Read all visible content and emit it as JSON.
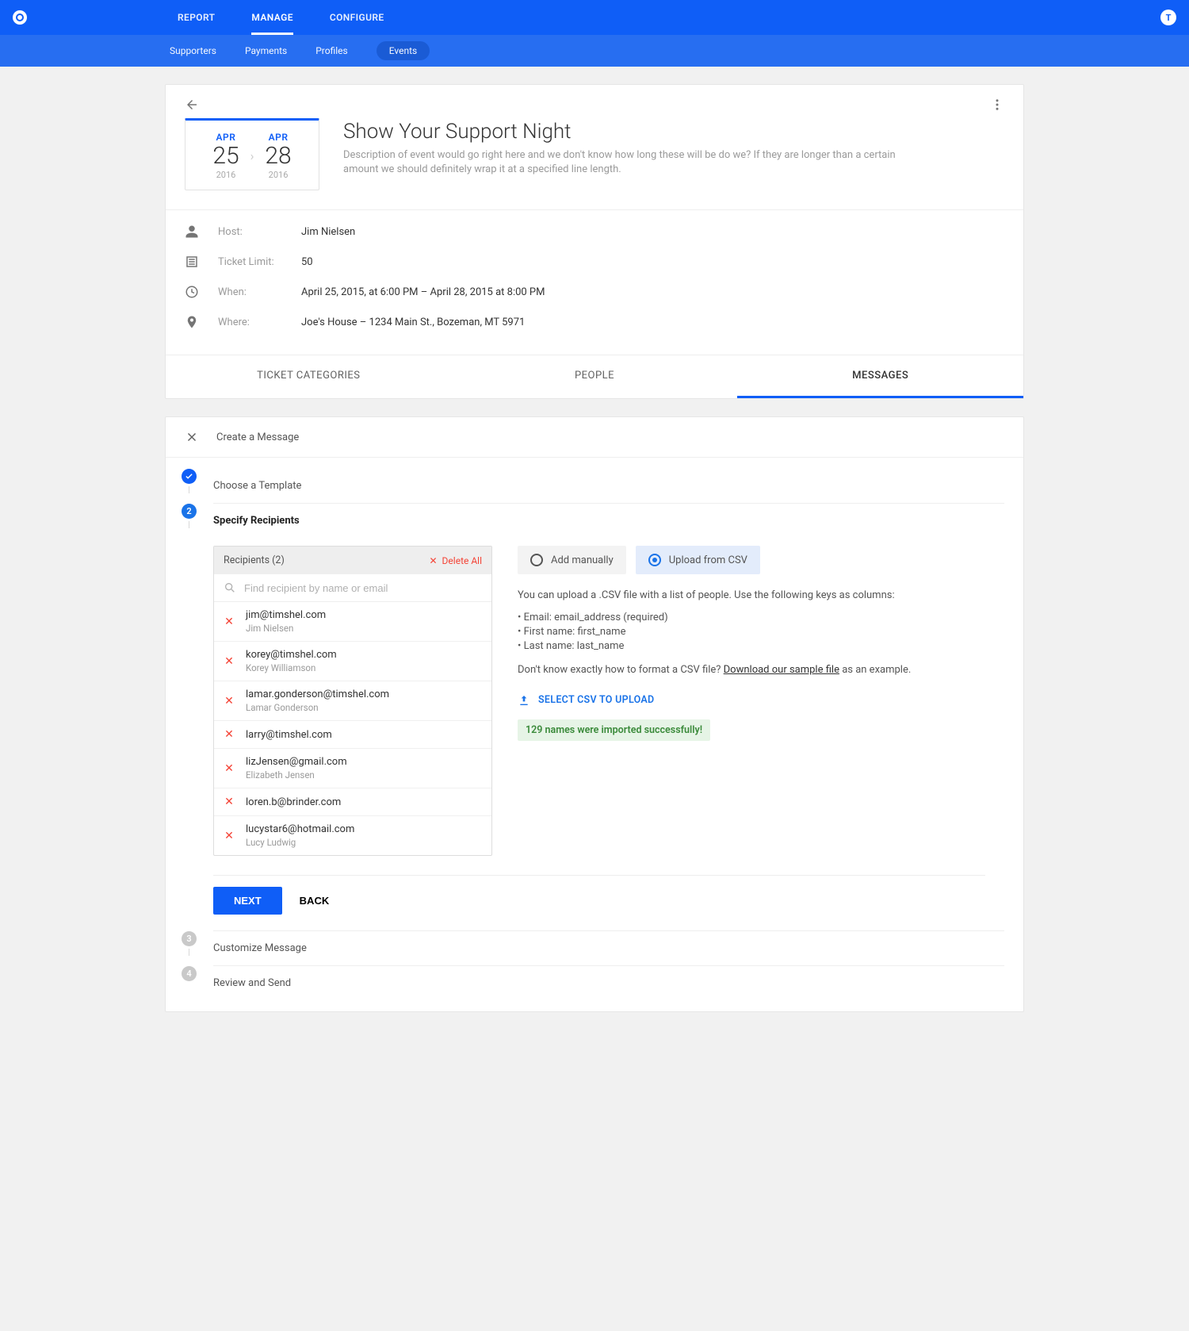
{
  "nav": {
    "tabs": [
      "REPORT",
      "MANAGE",
      "CONFIGURE"
    ],
    "active_tab": 1,
    "sub_tabs": [
      "Supporters",
      "Payments",
      "Profiles",
      "Events"
    ],
    "active_sub": 3,
    "avatar_initial": "T"
  },
  "event": {
    "date_start": {
      "month": "APR",
      "day": "25",
      "year": "2016"
    },
    "date_end": {
      "month": "APR",
      "day": "28",
      "year": "2016"
    },
    "title": "Show Your Support Night",
    "description": "Description of event would go right here and we don't know how long these will be do we? If they are longer than a certain amount we should definitely wrap it at a specified line length.",
    "meta": {
      "host_label": "Host:",
      "host_value": "Jim Nielsen",
      "limit_label": "Ticket Limit:",
      "limit_value": "50",
      "when_label": "When:",
      "when_value": "April 25, 2015, at 6:00 PM – April 28, 2015 at 8:00 PM",
      "where_label": "Where:",
      "where_value": "Joe's House – 1234 Main St., Bozeman, MT 5971"
    },
    "section_tabs": [
      "TICKET CATEGORIES",
      "PEOPLE",
      "MESSAGES"
    ],
    "active_section": 2
  },
  "wizard": {
    "header": "Create a Message",
    "steps": {
      "s1": "Choose a Template",
      "s2": "Specify Recipients",
      "s3": "Customize Message",
      "s4": "Review and Send"
    },
    "recipients_header": "Recipients (2)",
    "delete_all": "Delete All",
    "search_placeholder": "Find recipient by name or email",
    "recipients": [
      {
        "email": "jim@timshel.com",
        "name": "Jim Nielsen"
      },
      {
        "email": "korey@timshel.com",
        "name": "Korey Williamson"
      },
      {
        "email": "lamar.gonderson@timshel.com",
        "name": "Lamar Gonderson"
      },
      {
        "email": "larry@timshel.com",
        "name": ""
      },
      {
        "email": "lizJensen@gmail.com",
        "name": "Elizabeth Jensen"
      },
      {
        "email": "loren.b@brinder.com",
        "name": ""
      },
      {
        "email": "lucystar6@hotmail.com",
        "name": "Lucy Ludwig"
      }
    ],
    "toggle": {
      "manual": "Add manually",
      "csv": "Upload from CSV"
    },
    "csv_help_intro": "You can upload a .CSV file with a list of people. Use the following keys as columns:",
    "csv_keys": [
      "Email: email_address (required)",
      "First name: first_name",
      "Last name: last_name"
    ],
    "csv_help_q": "Don't know exactly how to format a CSV file? ",
    "csv_link": "Download our sample file",
    "csv_help_tail": " as an example.",
    "select_csv": "SELECT CSV TO UPLOAD",
    "success_msg": "129 names were imported successfully!",
    "next": "NEXT",
    "back": "BACK"
  }
}
